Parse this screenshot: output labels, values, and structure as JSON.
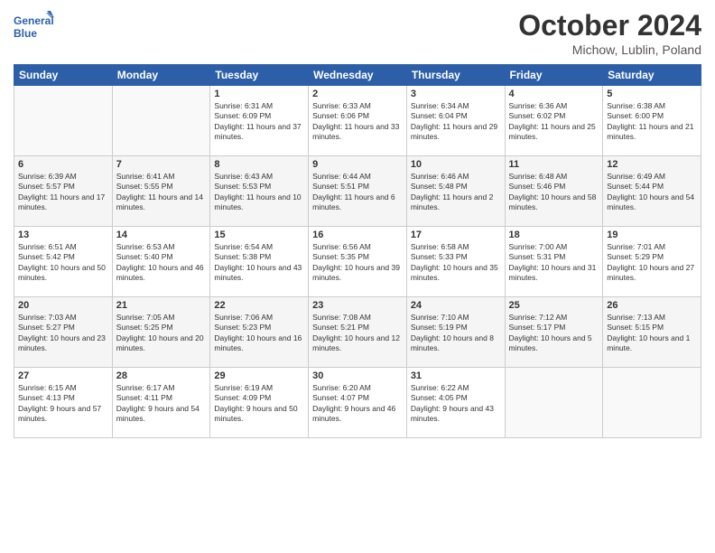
{
  "header": {
    "logo_line1": "General",
    "logo_line2": "Blue",
    "month": "October 2024",
    "location": "Michow, Lublin, Poland"
  },
  "weekdays": [
    "Sunday",
    "Monday",
    "Tuesday",
    "Wednesday",
    "Thursday",
    "Friday",
    "Saturday"
  ],
  "rows": [
    [
      {
        "num": "",
        "text": ""
      },
      {
        "num": "",
        "text": ""
      },
      {
        "num": "1",
        "text": "Sunrise: 6:31 AM\nSunset: 6:09 PM\nDaylight: 11 hours and 37 minutes."
      },
      {
        "num": "2",
        "text": "Sunrise: 6:33 AM\nSunset: 6:06 PM\nDaylight: 11 hours and 33 minutes."
      },
      {
        "num": "3",
        "text": "Sunrise: 6:34 AM\nSunset: 6:04 PM\nDaylight: 11 hours and 29 minutes."
      },
      {
        "num": "4",
        "text": "Sunrise: 6:36 AM\nSunset: 6:02 PM\nDaylight: 11 hours and 25 minutes."
      },
      {
        "num": "5",
        "text": "Sunrise: 6:38 AM\nSunset: 6:00 PM\nDaylight: 11 hours and 21 minutes."
      }
    ],
    [
      {
        "num": "6",
        "text": "Sunrise: 6:39 AM\nSunset: 5:57 PM\nDaylight: 11 hours and 17 minutes."
      },
      {
        "num": "7",
        "text": "Sunrise: 6:41 AM\nSunset: 5:55 PM\nDaylight: 11 hours and 14 minutes."
      },
      {
        "num": "8",
        "text": "Sunrise: 6:43 AM\nSunset: 5:53 PM\nDaylight: 11 hours and 10 minutes."
      },
      {
        "num": "9",
        "text": "Sunrise: 6:44 AM\nSunset: 5:51 PM\nDaylight: 11 hours and 6 minutes."
      },
      {
        "num": "10",
        "text": "Sunrise: 6:46 AM\nSunset: 5:48 PM\nDaylight: 11 hours and 2 minutes."
      },
      {
        "num": "11",
        "text": "Sunrise: 6:48 AM\nSunset: 5:46 PM\nDaylight: 10 hours and 58 minutes."
      },
      {
        "num": "12",
        "text": "Sunrise: 6:49 AM\nSunset: 5:44 PM\nDaylight: 10 hours and 54 minutes."
      }
    ],
    [
      {
        "num": "13",
        "text": "Sunrise: 6:51 AM\nSunset: 5:42 PM\nDaylight: 10 hours and 50 minutes."
      },
      {
        "num": "14",
        "text": "Sunrise: 6:53 AM\nSunset: 5:40 PM\nDaylight: 10 hours and 46 minutes."
      },
      {
        "num": "15",
        "text": "Sunrise: 6:54 AM\nSunset: 5:38 PM\nDaylight: 10 hours and 43 minutes."
      },
      {
        "num": "16",
        "text": "Sunrise: 6:56 AM\nSunset: 5:35 PM\nDaylight: 10 hours and 39 minutes."
      },
      {
        "num": "17",
        "text": "Sunrise: 6:58 AM\nSunset: 5:33 PM\nDaylight: 10 hours and 35 minutes."
      },
      {
        "num": "18",
        "text": "Sunrise: 7:00 AM\nSunset: 5:31 PM\nDaylight: 10 hours and 31 minutes."
      },
      {
        "num": "19",
        "text": "Sunrise: 7:01 AM\nSunset: 5:29 PM\nDaylight: 10 hours and 27 minutes."
      }
    ],
    [
      {
        "num": "20",
        "text": "Sunrise: 7:03 AM\nSunset: 5:27 PM\nDaylight: 10 hours and 23 minutes."
      },
      {
        "num": "21",
        "text": "Sunrise: 7:05 AM\nSunset: 5:25 PM\nDaylight: 10 hours and 20 minutes."
      },
      {
        "num": "22",
        "text": "Sunrise: 7:06 AM\nSunset: 5:23 PM\nDaylight: 10 hours and 16 minutes."
      },
      {
        "num": "23",
        "text": "Sunrise: 7:08 AM\nSunset: 5:21 PM\nDaylight: 10 hours and 12 minutes."
      },
      {
        "num": "24",
        "text": "Sunrise: 7:10 AM\nSunset: 5:19 PM\nDaylight: 10 hours and 8 minutes."
      },
      {
        "num": "25",
        "text": "Sunrise: 7:12 AM\nSunset: 5:17 PM\nDaylight: 10 hours and 5 minutes."
      },
      {
        "num": "26",
        "text": "Sunrise: 7:13 AM\nSunset: 5:15 PM\nDaylight: 10 hours and 1 minute."
      }
    ],
    [
      {
        "num": "27",
        "text": "Sunrise: 6:15 AM\nSunset: 4:13 PM\nDaylight: 9 hours and 57 minutes."
      },
      {
        "num": "28",
        "text": "Sunrise: 6:17 AM\nSunset: 4:11 PM\nDaylight: 9 hours and 54 minutes."
      },
      {
        "num": "29",
        "text": "Sunrise: 6:19 AM\nSunset: 4:09 PM\nDaylight: 9 hours and 50 minutes."
      },
      {
        "num": "30",
        "text": "Sunrise: 6:20 AM\nSunset: 4:07 PM\nDaylight: 9 hours and 46 minutes."
      },
      {
        "num": "31",
        "text": "Sunrise: 6:22 AM\nSunset: 4:05 PM\nDaylight: 9 hours and 43 minutes."
      },
      {
        "num": "",
        "text": ""
      },
      {
        "num": "",
        "text": ""
      }
    ]
  ]
}
